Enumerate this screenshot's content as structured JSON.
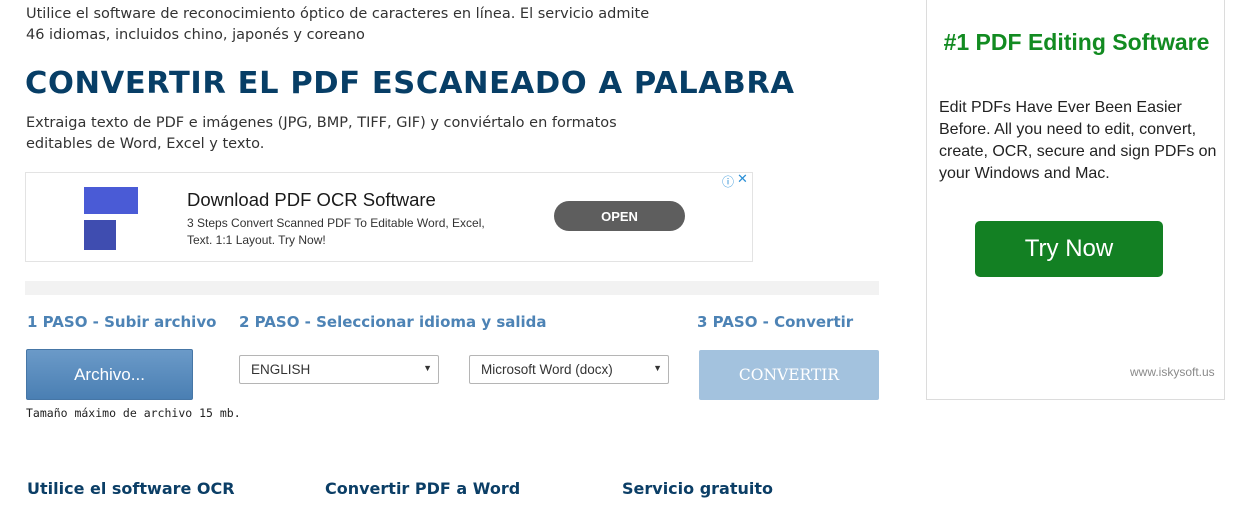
{
  "intro": {
    "line1": "Utilice el software de reconocimiento óptico de caracteres en línea. El servicio admite",
    "line2": "46 idiomas, incluidos chino, japonés y coreano"
  },
  "title": "CONVERTIR EL PDF ESCANEADO A PALABRA",
  "subtitle": {
    "line1": "Extraiga texto de PDF e imágenes (JPG, BMP, TIFF, GIF) y conviértalo en formatos",
    "line2": "editables de Word, Excel y texto."
  },
  "inline_ad": {
    "headline": "Download PDF OCR Software",
    "desc_line1": "3 Steps Convert Scanned PDF To Editable Word, Excel,",
    "desc_line2": "Text. 1:1 Layout. Try Now!",
    "cta": "OPEN",
    "info_glyph": "ⓘ",
    "close_glyph": "✕"
  },
  "steps": {
    "step1": "1 PASO - Subir archivo",
    "step2": "2 PASO - Seleccionar idioma y salida",
    "step3": "3 PASO - Convertir"
  },
  "controls": {
    "file_button": "Archivo...",
    "language_select": "ENGLISH",
    "output_select": "Microsoft Word (docx)",
    "convert_button": "CONVERTIR",
    "max_size": "Tamaño máximo de archivo 15 mb."
  },
  "bottom_links": [
    "Utilice el software OCR",
    "Convertir PDF a Word",
    "Servicio gratuito"
  ],
  "side_ad": {
    "title": "#1 PDF Editing Software",
    "text_line1": "Edit PDFs Have Ever Been Easier",
    "text_line2": "Before. All you need to edit, convert,",
    "text_line3": "create, OCR, secure and sign PDFs on",
    "text_line4": "your Windows and Mac.",
    "cta": "Try Now",
    "domain": "www.iskysoft.us"
  },
  "colors": {
    "title": "#073e66",
    "step_text": "#4d83b5",
    "file_button": "#5b8dbf",
    "convert_button_disabled": "#a3c2de",
    "side_ad_title": "#128b21",
    "try_button": "#138023"
  },
  "icons": {
    "select_arrow": "dropdown-arrow-icon",
    "ad_info": "info-icon",
    "ad_close": "close-icon"
  }
}
